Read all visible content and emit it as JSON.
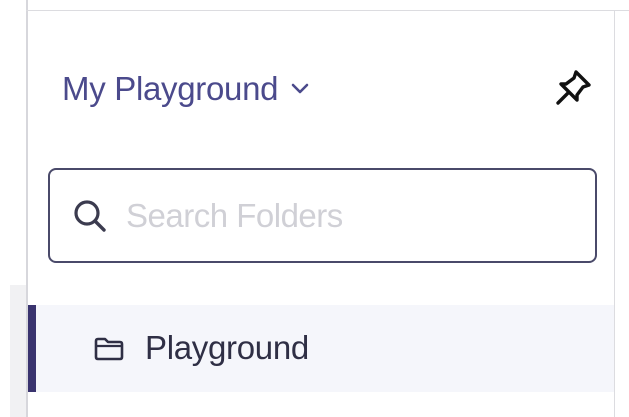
{
  "sidebar": {
    "workspace": {
      "title": "My Playground",
      "dropdown_icon": "chevron-down-icon"
    },
    "pin_icon": "pushpin-icon",
    "search": {
      "placeholder": "Search Folders",
      "value": "",
      "icon": "search-icon"
    },
    "folders": [
      {
        "label": "Playground",
        "icon": "folder-icon",
        "selected": true
      }
    ]
  },
  "colors": {
    "workspace_title": "#4b4a8c",
    "active_indicator": "#39336e",
    "selected_row_bg": "#f5f6fb",
    "search_border": "#4a4a6a",
    "placeholder": "#d0d0d6"
  }
}
